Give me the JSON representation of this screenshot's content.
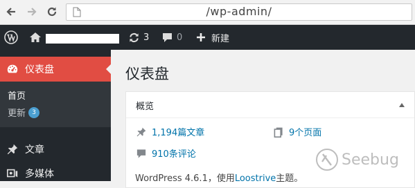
{
  "browser": {
    "url": "/wp-admin/"
  },
  "adminbar": {
    "updates_count": "3",
    "comments_count": "0",
    "new_label": "新建"
  },
  "sidebar": {
    "dashboard_label": "仪表盘",
    "submenu": [
      {
        "label": "首页"
      },
      {
        "label": "更新",
        "badge": "3"
      }
    ],
    "items": [
      {
        "label": "文章"
      },
      {
        "label": "多媒体"
      }
    ]
  },
  "main": {
    "title": "仪表盘",
    "box_title": "概览",
    "stats": {
      "posts": "1,194篇文章",
      "pages": "9个页面",
      "comments": "910条评论"
    },
    "version_prefix": "WordPress 4.6.1，使用",
    "theme_name": "Loostrive",
    "version_suffix": "主题。"
  },
  "watermark": {
    "text": "Seebug"
  },
  "colors": {
    "adminbar": "#23282d",
    "active_menu": "#e14d43",
    "link": "#0073aa",
    "badge": "#4b9fd1"
  }
}
